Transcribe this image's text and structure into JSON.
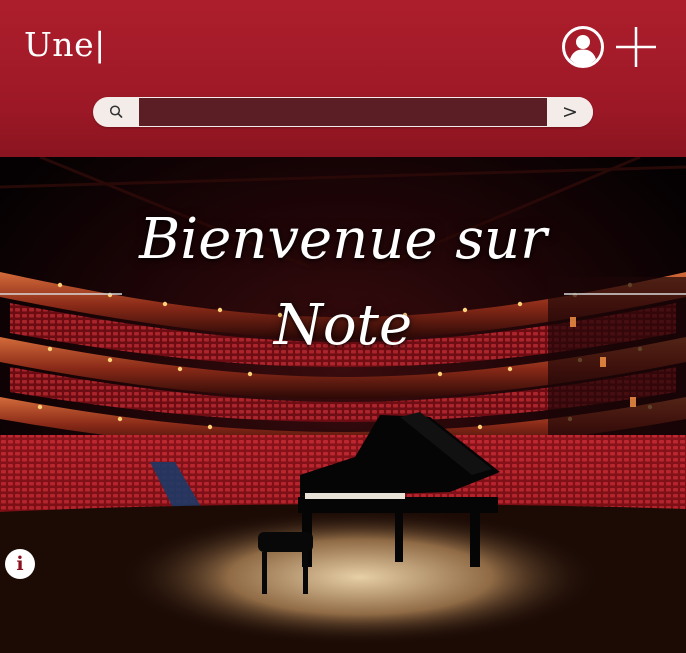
{
  "header": {
    "logo_text": "Une|",
    "search": {
      "placeholder": "",
      "value": "",
      "submit_label": ">"
    },
    "icons": {
      "search": "search-icon",
      "account": "user-circle-icon",
      "add": "plus-icon"
    }
  },
  "hero": {
    "title_line1": "Bienvenue sur",
    "title_line2": "Note",
    "info_label": "i",
    "image": "concert-hall-grand-piano"
  },
  "colors": {
    "header_red": "#ad1e2c",
    "search_field": "#5a1e24",
    "search_pill": "#f3ece9",
    "seat_red": "#a3141f",
    "info_icon": "#8b0f1c"
  }
}
